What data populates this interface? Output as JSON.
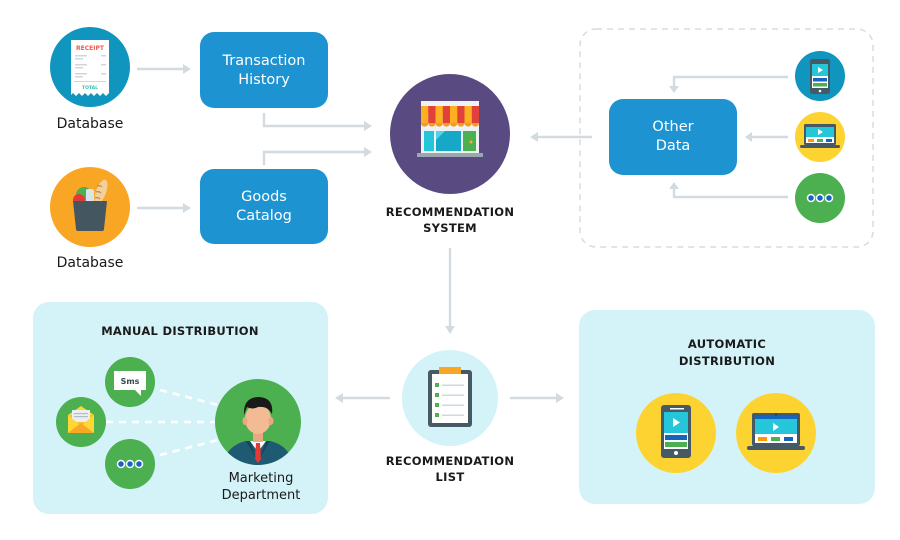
{
  "colors": {
    "box_blue": "#1e93d2",
    "teal": "#0f95be",
    "orange": "#f8a623",
    "purple": "#5a4a82",
    "green": "#4caf50",
    "yellow": "#fdd332",
    "light_cyan": "#d4f3f8",
    "arrow_gray": "#d3dbe0",
    "text": "#1a1a1a"
  },
  "sources": {
    "receipt_db": {
      "label": "Database",
      "icon": "receipt-icon",
      "receipt_title": "RECEIPT",
      "receipt_total": "TOTAL"
    },
    "grocery_db": {
      "label": "Database",
      "icon": "grocery-bag-icon"
    }
  },
  "boxes": {
    "transaction_history": {
      "line1": "Transaction",
      "line2": "History"
    },
    "goods_catalog": {
      "line1": "Goods",
      "line2": "Catalog"
    },
    "other_data": {
      "line1": "Other",
      "line2": "Data"
    }
  },
  "other_data_sources": [
    {
      "icon": "smartphone-icon"
    },
    {
      "icon": "laptop-icon"
    },
    {
      "icon": "more-dots-icon"
    }
  ],
  "recommendation_system": {
    "line1": "RECOMMENDATION",
    "line2": "SYSTEM",
    "icon": "storefront-icon"
  },
  "recommendation_list": {
    "line1": "RECOMMENDATION",
    "line2": "LIST",
    "icon": "clipboard-checklist-icon"
  },
  "manual_distribution": {
    "title": "MANUAL DISTRIBUTION",
    "channels": [
      {
        "icon": "sms-bubble-icon",
        "text": "Sms"
      },
      {
        "icon": "email-envelope-icon"
      },
      {
        "icon": "more-dots-icon"
      }
    ],
    "department": {
      "line1": "Marketing",
      "line2": "Department",
      "icon": "businessman-avatar-icon"
    }
  },
  "automatic_distribution": {
    "title_line1": "AUTOMATIC",
    "title_line2": "DISTRIBUTION",
    "devices": [
      {
        "icon": "smartphone-icon"
      },
      {
        "icon": "laptop-icon"
      }
    ]
  }
}
